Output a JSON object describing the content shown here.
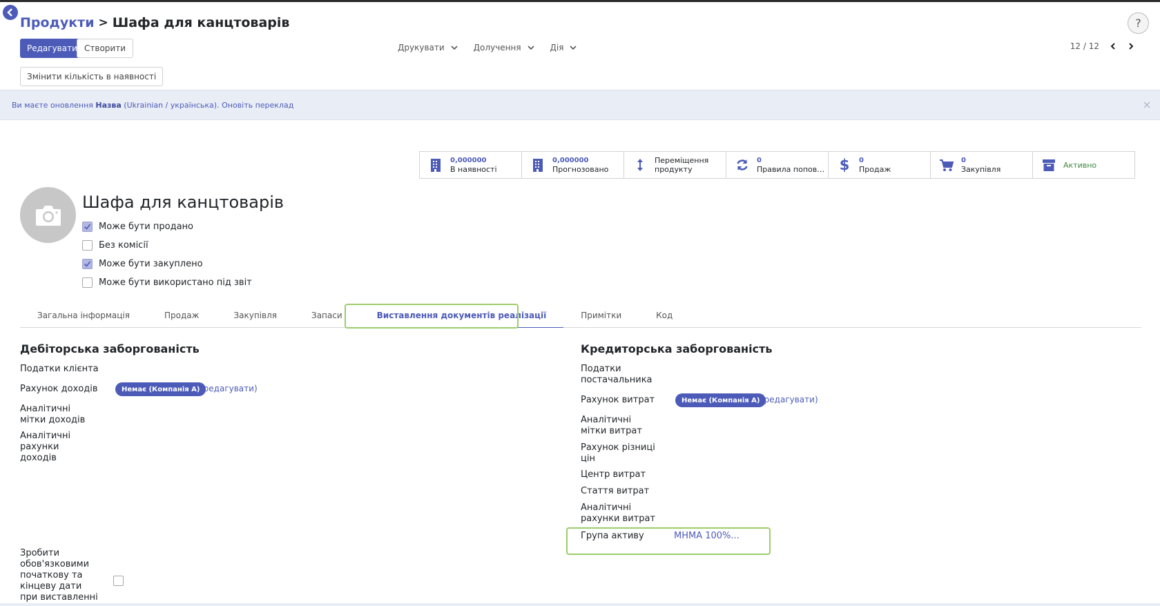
{
  "breadcrumb": {
    "parent": "Продукти",
    "separator": ">",
    "current": "Шафа для канцтоварів"
  },
  "help": {
    "label": "?"
  },
  "toolbar": {
    "edit_label": "Редагувати",
    "create_label": "Створити",
    "qty_label": "Змінити кількість в наявності"
  },
  "menus": [
    {
      "label": "Друкувати"
    },
    {
      "label": "Долучення"
    },
    {
      "label": "Дія"
    }
  ],
  "pager": {
    "text": "12 / 12"
  },
  "banner": {
    "prefix": "Ви маєте оновлення",
    "field": "Назва",
    "lang": "(Ukrainian / українська).",
    "link": "Оновіть переклад"
  },
  "stats": [
    {
      "value": "0,000000",
      "label": "В наявності",
      "icon": "building-icon"
    },
    {
      "value": "0,000000",
      "label": "Прогнозовано",
      "icon": "building-icon"
    },
    {
      "value": "",
      "label": "Переміщення продукту",
      "icon": "arrows-vertical-icon"
    },
    {
      "value": "0",
      "label": "Правила поповн…",
      "icon": "refresh-icon"
    },
    {
      "value": "0",
      "label": "Продаж",
      "icon": "dollar-icon"
    },
    {
      "value": "0",
      "label": "Закупівля",
      "icon": "cart-icon"
    },
    {
      "value": "",
      "label": "Активно",
      "icon": "archive-icon"
    }
  ],
  "product": {
    "name": "Шафа для канцтоварів",
    "options": [
      {
        "label": "Може бути продано",
        "checked": true
      },
      {
        "label": "Без комісії",
        "checked": false
      },
      {
        "label": "Може бути закуплено",
        "checked": true
      },
      {
        "label": "Може бути використано під звіт",
        "checked": false
      }
    ]
  },
  "tabs": [
    {
      "label": "Загальна інформація"
    },
    {
      "label": "Продаж"
    },
    {
      "label": "Закупівля"
    },
    {
      "label": "Запаси"
    },
    {
      "label": "Виставлення документів реалізації",
      "active": true
    },
    {
      "label": "Примітки"
    },
    {
      "label": "Код"
    }
  ],
  "receivable": {
    "title": "Дебіторська заборгованість",
    "customer_taxes": "Податки клієнта",
    "income_account": "Рахунок доходів",
    "income_account_value": "Немає (Компанія А)",
    "edit": "(редагувати)",
    "income_tags": "Аналітичні мітки доходів",
    "income_analytic": "Аналітичні рахунки доходів",
    "mandatory_dates": "Зробити обов'язковими початкову та кінцеву дати при виставленні"
  },
  "payable": {
    "title": "Кредиторська заборгованість",
    "vendor_taxes": "Податки постачальника",
    "expense_account": "Рахунок витрат",
    "expense_account_value": "Немає (Компанія А)",
    "edit": "(редагувати)",
    "expense_tags": "Аналітичні мітки витрат",
    "price_diff": "Рахунок різниці цін",
    "cost_center": "Центр витрат",
    "expense_item": "Стаття витрат",
    "expense_analytic": "Аналітичні рахунки витрат",
    "asset_group": "Група активу",
    "asset_group_value": "МНМА 100%..."
  },
  "colors": {
    "accent": "#4c5bb8",
    "highlight": "#9ccd6a",
    "active_green": "#3c8a3c"
  }
}
